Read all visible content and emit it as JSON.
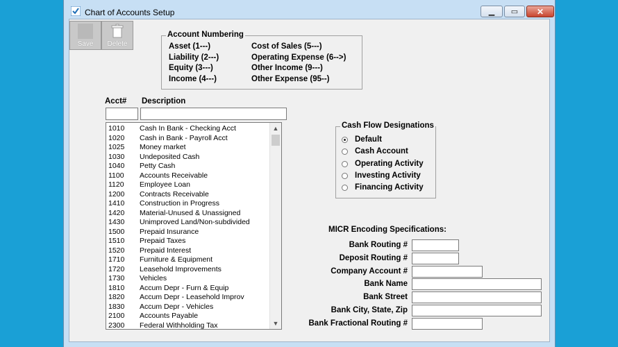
{
  "window": {
    "title": "Chart of Accounts Setup"
  },
  "toolbar": {
    "save_label": "Save",
    "delete_label": "Delete"
  },
  "account_numbering": {
    "title": "Account Numbering",
    "left": [
      "Asset (1---)",
      "Liability (2---)",
      "Equity (3---)",
      "Income (4---)"
    ],
    "right": [
      "Cost of Sales (5---)",
      "Operating Expense (6-->)",
      "Other Income (9---)",
      "Other Expense (95--)"
    ]
  },
  "columns": {
    "acct": "Acct#",
    "description": "Description"
  },
  "filters": {
    "acct_value": "",
    "description_value": ""
  },
  "accounts": [
    {
      "acct": "1010",
      "desc": "Cash In Bank - Checking Acct"
    },
    {
      "acct": "1020",
      "desc": "Cash in Bank - Payroll Acct"
    },
    {
      "acct": "1025",
      "desc": "Money market"
    },
    {
      "acct": "1030",
      "desc": "Undeposited Cash"
    },
    {
      "acct": "1040",
      "desc": "Petty Cash"
    },
    {
      "acct": "1100",
      "desc": "Accounts Receivable"
    },
    {
      "acct": "1120",
      "desc": "Employee Loan"
    },
    {
      "acct": "1200",
      "desc": "Contracts Receivable"
    },
    {
      "acct": "1410",
      "desc": "Construction in Progress"
    },
    {
      "acct": "1420",
      "desc": "Material-Unused & Unassigned"
    },
    {
      "acct": "1430",
      "desc": "Unimproved Land/Non-subdivided"
    },
    {
      "acct": "1500",
      "desc": "Prepaid Insurance"
    },
    {
      "acct": "1510",
      "desc": "Prepaid Taxes"
    },
    {
      "acct": "1520",
      "desc": "Prepaid Interest"
    },
    {
      "acct": "1710",
      "desc": "Furniture & Equipment"
    },
    {
      "acct": "1720",
      "desc": "Leasehold Improvements"
    },
    {
      "acct": "1730",
      "desc": "Vehicles"
    },
    {
      "acct": "1810",
      "desc": "Accum Depr - Furn & Equip"
    },
    {
      "acct": "1820",
      "desc": "Accum Depr - Leasehold Improv"
    },
    {
      "acct": "1830",
      "desc": "Accum Depr - Vehicles"
    },
    {
      "acct": "2100",
      "desc": "Accounts Payable"
    },
    {
      "acct": "2300",
      "desc": "Federal Withholding Tax"
    }
  ],
  "cash_flow": {
    "title": "Cash Flow Designations",
    "options": [
      "Default",
      "Cash Account",
      "Operating Activity",
      "Investing Activity",
      "Financing Activity"
    ],
    "selected": "Default"
  },
  "micr": {
    "title": "MICR Encoding Specifications:",
    "fields": [
      {
        "label": "Bank Routing #",
        "value": ""
      },
      {
        "label": "Deposit Routing #",
        "value": ""
      },
      {
        "label": "Company Account #",
        "value": ""
      },
      {
        "label": "Bank Name",
        "value": ""
      },
      {
        "label": "Bank Street",
        "value": ""
      },
      {
        "label": "Bank City, State, Zip",
        "value": ""
      },
      {
        "label": "Bank Fractional Routing #",
        "value": ""
      }
    ]
  },
  "colors": {
    "desktop": "#1aa0d6",
    "window_frame": "#c7dff4",
    "client": "#f0f0f0",
    "close_button": "#c8452f"
  }
}
